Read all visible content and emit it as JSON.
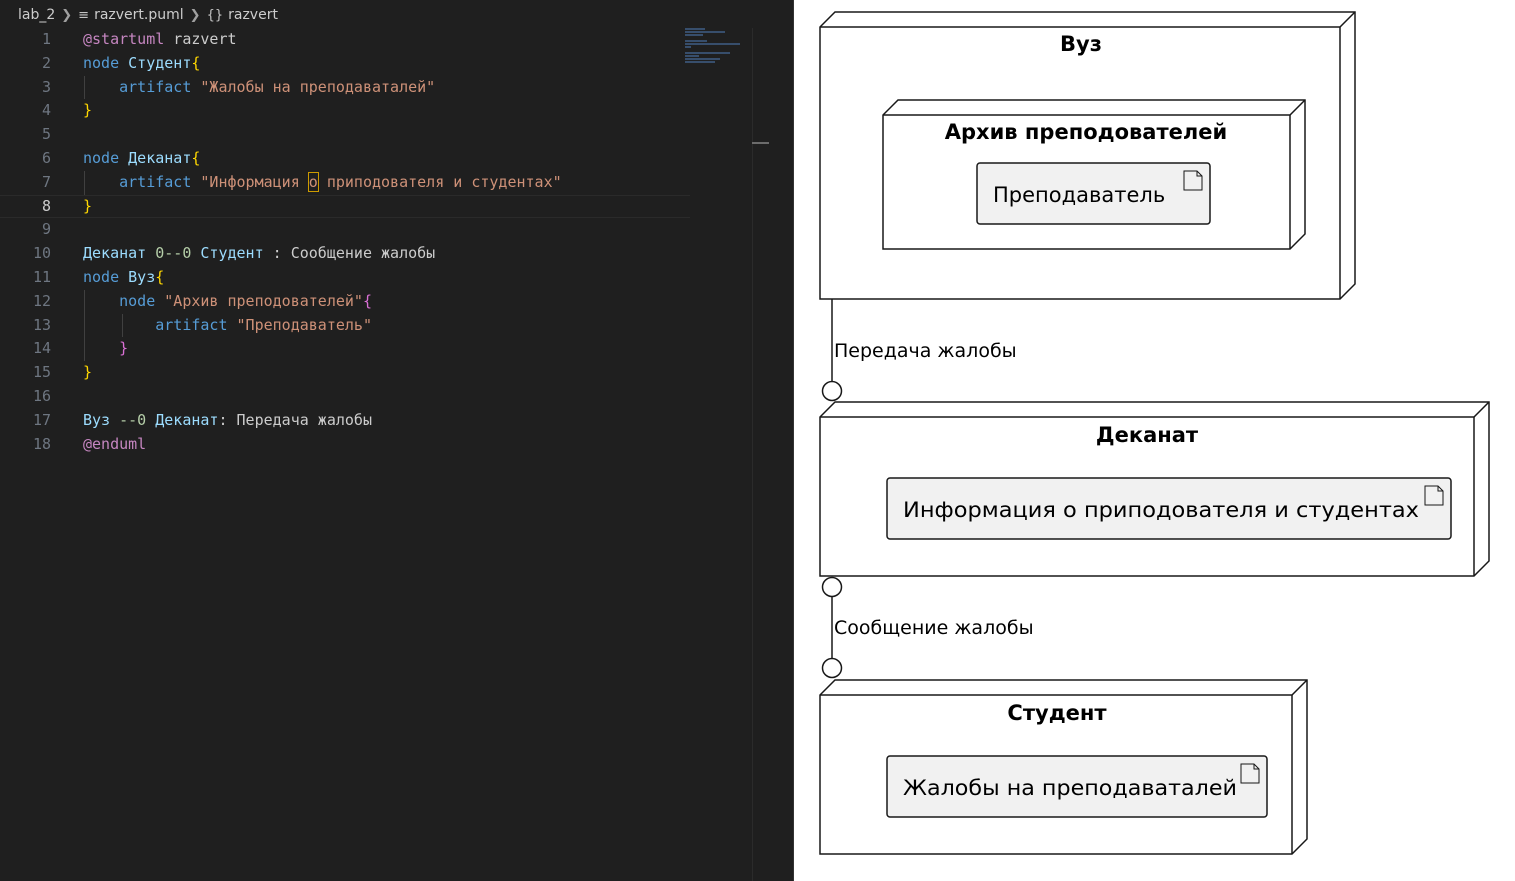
{
  "breadcrumb": {
    "folder": "lab_2",
    "file": "razvert.puml",
    "symbol": "razvert",
    "file_icon": "list-icon",
    "symbol_icon": "{}"
  },
  "editor": {
    "active_line": 8,
    "lines": [
      {
        "n": "1",
        "parts": [
          {
            "c": "dir",
            "t": "@startuml"
          },
          {
            "c": "plain",
            "t": " razvert"
          }
        ]
      },
      {
        "n": "2",
        "parts": [
          {
            "c": "kw",
            "t": "node"
          },
          {
            "c": "plain",
            "t": " "
          },
          {
            "c": "id",
            "t": "Студент"
          },
          {
            "c": "br1",
            "t": "{"
          }
        ]
      },
      {
        "n": "3",
        "parts": [
          {
            "c": "plain",
            "t": "    "
          },
          {
            "c": "kw",
            "t": "artifact"
          },
          {
            "c": "plain",
            "t": " "
          },
          {
            "c": "str",
            "t": "\"Жалобы на преподаваталей\""
          }
        ]
      },
      {
        "n": "4",
        "parts": [
          {
            "c": "br1",
            "t": "}"
          }
        ]
      },
      {
        "n": "5",
        "parts": []
      },
      {
        "n": "6",
        "parts": [
          {
            "c": "kw",
            "t": "node"
          },
          {
            "c": "plain",
            "t": " "
          },
          {
            "c": "id",
            "t": "Деканат"
          },
          {
            "c": "br1",
            "t": "{"
          }
        ]
      },
      {
        "n": "7",
        "parts": [
          {
            "c": "plain",
            "t": "    "
          },
          {
            "c": "kw",
            "t": "artifact"
          },
          {
            "c": "plain",
            "t": " "
          },
          {
            "c": "str",
            "t": "\"Информация "
          },
          {
            "c": "str hl",
            "t": "о"
          },
          {
            "c": "str",
            "t": " приподователя и студентах\""
          }
        ]
      },
      {
        "n": "8",
        "parts": [
          {
            "c": "br1",
            "t": "}"
          }
        ]
      },
      {
        "n": "9",
        "parts": []
      },
      {
        "n": "10",
        "parts": [
          {
            "c": "id",
            "t": "Деканат"
          },
          {
            "c": "plain",
            "t": " "
          },
          {
            "c": "num",
            "t": "0--0"
          },
          {
            "c": "plain",
            "t": " "
          },
          {
            "c": "id",
            "t": "Студент"
          },
          {
            "c": "plain",
            "t": " : Сообщение жалобы"
          }
        ]
      },
      {
        "n": "11",
        "parts": [
          {
            "c": "kw",
            "t": "node"
          },
          {
            "c": "plain",
            "t": " "
          },
          {
            "c": "id",
            "t": "Вуз"
          },
          {
            "c": "br1",
            "t": "{"
          }
        ]
      },
      {
        "n": "12",
        "parts": [
          {
            "c": "plain",
            "t": "    "
          },
          {
            "c": "kw",
            "t": "node"
          },
          {
            "c": "plain",
            "t": " "
          },
          {
            "c": "str",
            "t": "\"Архив преподователей\""
          },
          {
            "c": "br2",
            "t": "{"
          }
        ]
      },
      {
        "n": "13",
        "parts": [
          {
            "c": "plain",
            "t": "        "
          },
          {
            "c": "kw",
            "t": "artifact"
          },
          {
            "c": "plain",
            "t": " "
          },
          {
            "c": "str",
            "t": "\"Преподаватель\""
          }
        ]
      },
      {
        "n": "14",
        "parts": [
          {
            "c": "plain",
            "t": "    "
          },
          {
            "c": "br2",
            "t": "}"
          }
        ]
      },
      {
        "n": "15",
        "parts": [
          {
            "c": "br1",
            "t": "}"
          }
        ]
      },
      {
        "n": "16",
        "parts": []
      },
      {
        "n": "17",
        "parts": [
          {
            "c": "id",
            "t": "Вуз"
          },
          {
            "c": "plain",
            "t": " "
          },
          {
            "c": "num",
            "t": "--0"
          },
          {
            "c": "plain",
            "t": " "
          },
          {
            "c": "id",
            "t": "Деканат"
          },
          {
            "c": "plain",
            "t": ": Передача жалобы"
          }
        ]
      },
      {
        "n": "18",
        "parts": [
          {
            "c": "dir",
            "t": "@enduml"
          }
        ]
      }
    ]
  },
  "diagram": {
    "nodes": {
      "vuz": {
        "title": "Вуз"
      },
      "archive": {
        "title": "Архив преподователей"
      },
      "dekanat": {
        "title": "Деканат"
      },
      "student": {
        "title": "Студент"
      }
    },
    "artifacts": {
      "teacher": "Преподаватель",
      "info": "Информация о приподователя и студентах",
      "complaints": "Жалобы на преподаваталей"
    },
    "links": {
      "vuz_dekanat": "Передача жалобы",
      "dekanat_student": "Сообщение жалобы"
    },
    "colors": {
      "editor_bg": "#1f1f1f",
      "keyword": "#569cd6",
      "identifier": "#9cdcfe",
      "string": "#ce9178",
      "bracket_1": "#ffd700",
      "bracket_2": "#da70d6",
      "artifact_fill": "#f1f1f1"
    }
  }
}
